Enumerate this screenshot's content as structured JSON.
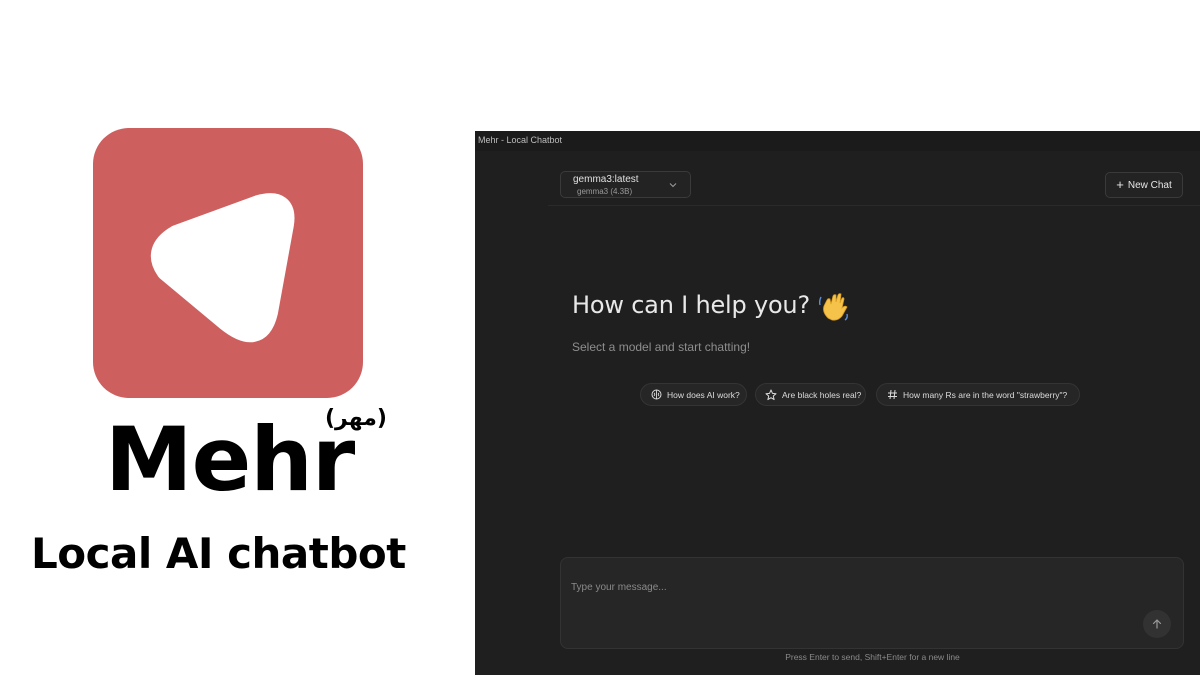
{
  "brand": {
    "name": "Mehr",
    "native_name": "(مهر)",
    "tagline": "Local AI chatbot",
    "accent_color": "#cd5f5f"
  },
  "window": {
    "title": "Mehr - Local Chatbot"
  },
  "model_selector": {
    "name": "gemma3:latest",
    "detail": "gemma3 (4.3B)",
    "icon": "chevron-down-icon"
  },
  "toolbar": {
    "new_chat_label": "New Chat",
    "new_chat_icon": "plus-icon"
  },
  "welcome": {
    "heading": "How can I help you?",
    "heading_icon": "wave-icon",
    "subtitle": "Select a model and start chatting!"
  },
  "suggestions": [
    {
      "label": "How does AI work?",
      "icon": "brain-icon"
    },
    {
      "label": "Are black holes real?",
      "icon": "star-icon"
    },
    {
      "label": "How many Rs are in the word \"strawberry\"?",
      "icon": "hash-icon"
    }
  ],
  "composer": {
    "placeholder": "Type your message...",
    "send_icon": "arrow-up-icon",
    "hint": "Press Enter to send, Shift+Enter for a new line"
  }
}
